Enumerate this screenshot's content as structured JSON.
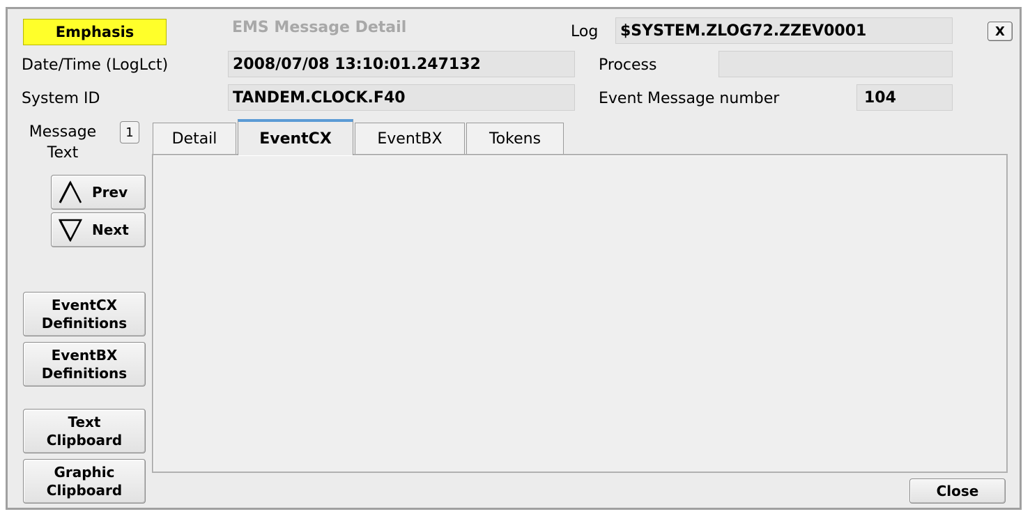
{
  "header": {
    "emphasis": "Emphasis",
    "title": "EMS Message Detail",
    "log_label": "Log",
    "log_value": "$SYSTEM.ZLOG72.ZZEV0001",
    "close_x": "X"
  },
  "fields": {
    "datetime_label": "Date/Time (LogLct)",
    "datetime_value": "2008/07/08 13:10:01.247132",
    "process_label": "Process",
    "process_value": "",
    "systemid_label": "System ID",
    "systemid_value": "TANDEM.CLOCK.F40",
    "eventnum_label": "Event Message number",
    "eventnum_value": "104"
  },
  "message": {
    "label_line1": "Message",
    "label_line2": "Text",
    "counter": "1"
  },
  "nav": {
    "prev": "Prev",
    "next": "Next"
  },
  "side_buttons": {
    "eventcx_line1": "EventCX",
    "eventcx_line2": "Definitions",
    "eventbx_line1": "EventBX",
    "eventbx_line2": "Definitions",
    "text_line1": "Text",
    "text_line2": "Clipboard",
    "graphic_line1": "Graphic",
    "graphic_line2": "Clipboard"
  },
  "tabs": [
    {
      "label": "Detail",
      "active": false
    },
    {
      "label": "EventCX",
      "active": true
    },
    {
      "label": "EventBX",
      "active": false
    },
    {
      "label": "Tokens",
      "active": false
    }
  ],
  "footer": {
    "close": "Close"
  },
  "colors": {
    "emphasis_bg": "#ffff2a",
    "active_tab_accent": "#5b9bd5",
    "window_bg": "#ececec"
  }
}
